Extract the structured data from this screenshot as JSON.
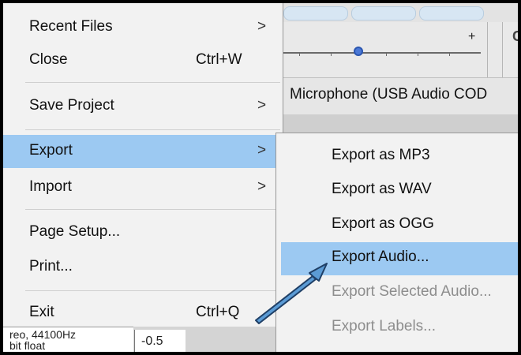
{
  "background": {
    "device_label": "Microphone (USB Audio COD",
    "track_info": [
      "reo, 44100Hz",
      "bit float"
    ],
    "scale_label": "-0.5"
  },
  "file_menu": {
    "items": [
      {
        "label": "Recent Files",
        "shortcut": "",
        "has_submenu": true
      },
      {
        "label": "Close",
        "shortcut": "Ctrl+W",
        "has_submenu": false
      },
      {
        "label": "Save Project",
        "shortcut": "",
        "has_submenu": true
      },
      {
        "label": "Export",
        "shortcut": "",
        "has_submenu": true,
        "highlighted": true
      },
      {
        "label": "Import",
        "shortcut": "",
        "has_submenu": true
      },
      {
        "label": "Page Setup...",
        "shortcut": "",
        "has_submenu": false
      },
      {
        "label": "Print...",
        "shortcut": "",
        "has_submenu": false
      },
      {
        "label": "Exit",
        "shortcut": "Ctrl+Q",
        "has_submenu": false
      }
    ],
    "submenu_arrow": ">"
  },
  "export_submenu": {
    "items": [
      {
        "label": "Export as MP3",
        "enabled": true
      },
      {
        "label": "Export as WAV",
        "enabled": true
      },
      {
        "label": "Export as OGG",
        "enabled": true
      },
      {
        "label": "Export Audio...",
        "enabled": true,
        "highlighted": true
      },
      {
        "label": "Export Selected Audio...",
        "enabled": false
      },
      {
        "label": "Export Labels...",
        "enabled": false
      }
    ]
  },
  "colors": {
    "highlight": "#9cc9f2",
    "menu_bg": "#f2f2f2",
    "annotation_arrow": "#5b9bd5",
    "disabled_text": "#8d8d8d"
  },
  "annotation": {
    "icon": "pointer-arrow-icon",
    "points_to": "Export Audio..."
  }
}
